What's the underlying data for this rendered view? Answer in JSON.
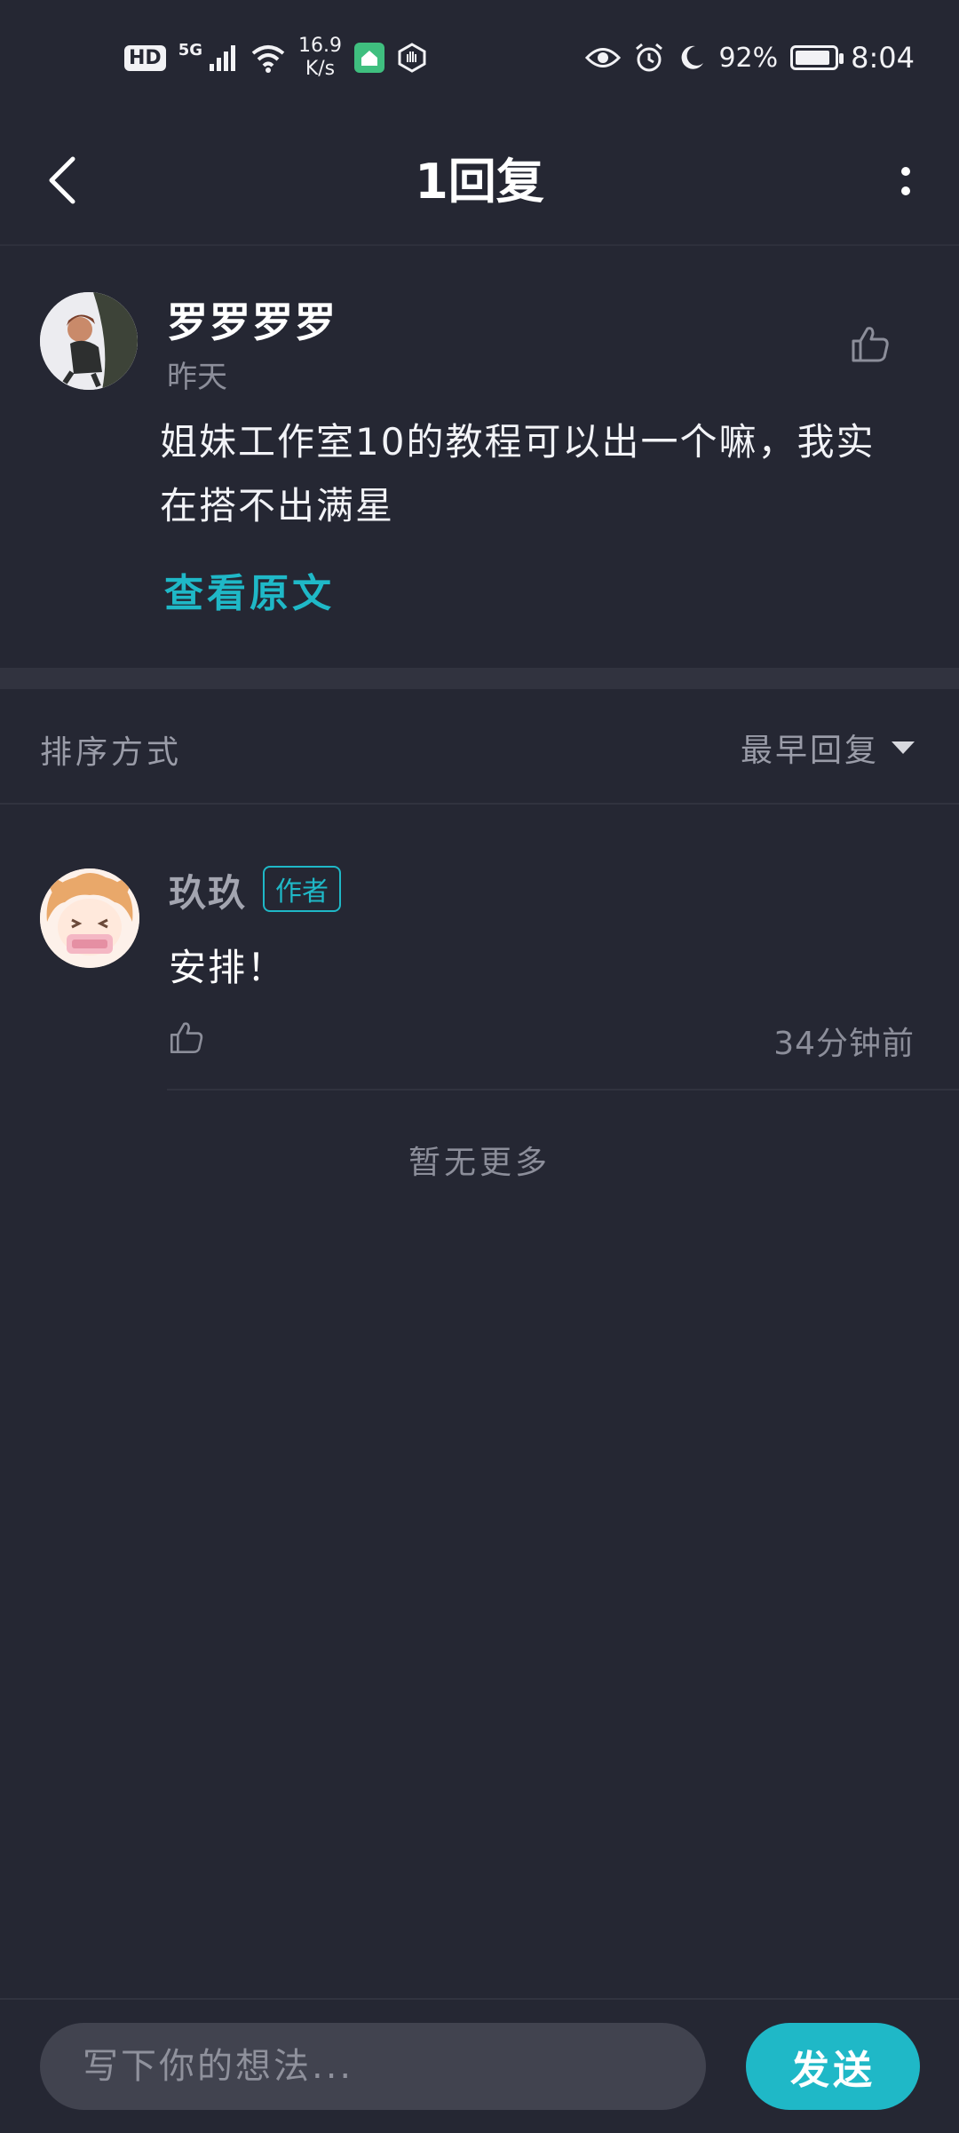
{
  "status_bar": {
    "hd": "HD",
    "network": "5G",
    "speed_value": "16.9",
    "speed_unit": "K/s",
    "battery_pct": "92%",
    "battery_level": 0.92,
    "time": "8:04"
  },
  "header": {
    "title": "1回复"
  },
  "post": {
    "author": "罗罗罗罗",
    "time": "昨天",
    "text": "姐妹工作室10的教程可以出一个嘛，我实在搭不出满星",
    "view_original": "查看原文"
  },
  "sort": {
    "label": "排序方式",
    "value": "最早回复"
  },
  "reply": {
    "author": "玖玖",
    "badge": "作者",
    "text": "安排！",
    "time": "34分钟前"
  },
  "footer_note": "暂无更多",
  "composer": {
    "placeholder": "写下你的想法...",
    "send_label": "发送"
  },
  "colors": {
    "background": "#252733",
    "accent": "#1fb8c7"
  }
}
